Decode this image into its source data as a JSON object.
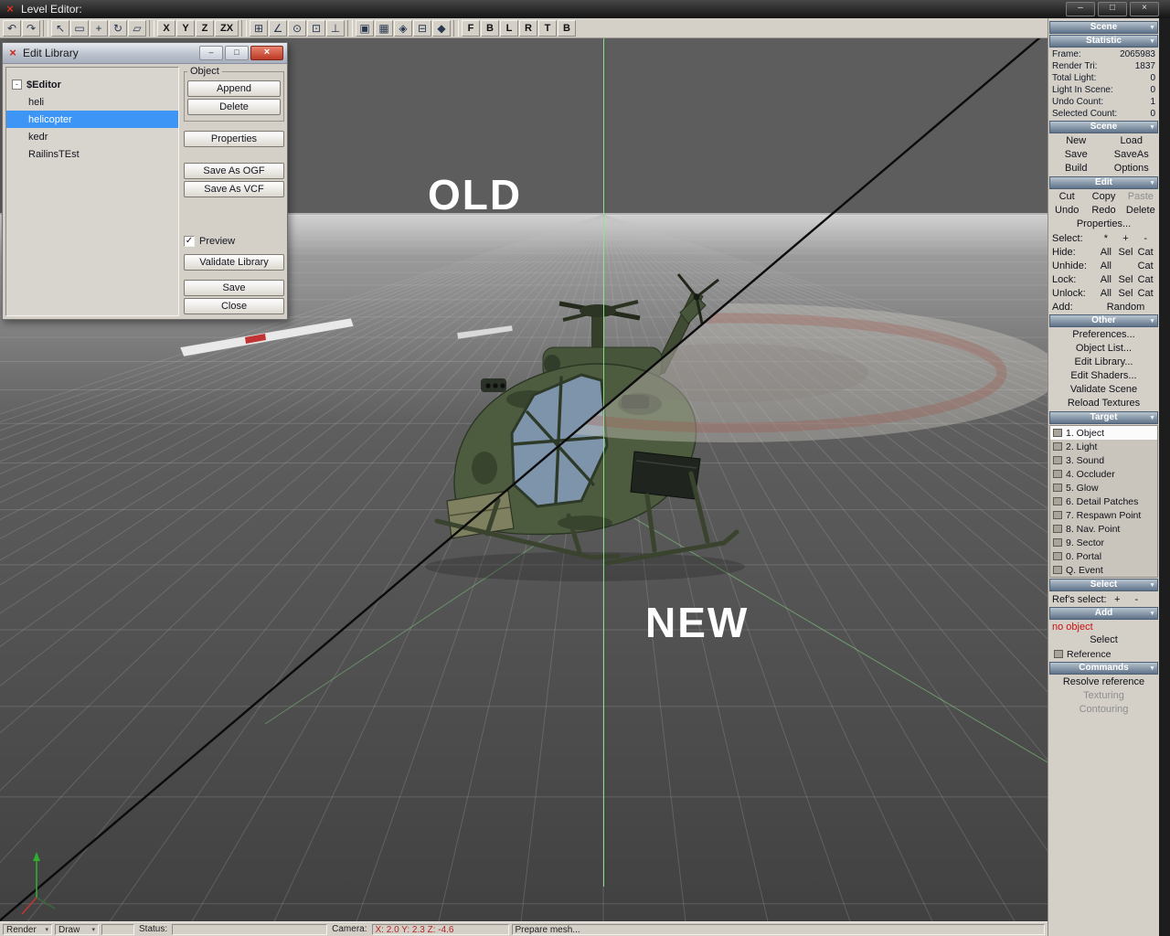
{
  "window": {
    "title": "Level Editor:"
  },
  "colors": {
    "selection_blue": "#3d95f5",
    "panel_header": "#65798d",
    "error_red": "#cc1010",
    "axis_green": "#8ce48c",
    "coords_red": "#b42222",
    "titlebar_dark": "#1c1c1c"
  },
  "toolbar": {
    "buttons": [
      {
        "name": "undo",
        "glyph": "↶"
      },
      {
        "name": "redo",
        "glyph": "↷"
      },
      {
        "sep": true
      },
      {
        "name": "select-tool",
        "glyph": "↖"
      },
      {
        "name": "select-rect-tool",
        "glyph": "▭"
      },
      {
        "name": "move-tool",
        "glyph": "+"
      },
      {
        "name": "rotate-tool",
        "glyph": "↻"
      },
      {
        "name": "scale-tool",
        "glyph": "▱"
      },
      {
        "sep": true
      },
      {
        "name": "axis-x",
        "glyph": "X",
        "letter": true
      },
      {
        "name": "axis-y",
        "glyph": "Y",
        "letter": true
      },
      {
        "name": "axis-z",
        "glyph": "Z",
        "letter": true
      },
      {
        "name": "axis-zx",
        "glyph": "ZX",
        "letter": true,
        "wide": true
      },
      {
        "sep": true
      },
      {
        "name": "grid-snap",
        "glyph": "⊞"
      },
      {
        "name": "angle-snap",
        "glyph": "∠"
      },
      {
        "name": "vertex-snap",
        "glyph": "⊙"
      },
      {
        "name": "face-snap",
        "glyph": "⊡"
      },
      {
        "name": "normal-align",
        "glyph": "⊥"
      },
      {
        "sep": true
      },
      {
        "name": "render-fill",
        "glyph": "▣"
      },
      {
        "name": "render-wire",
        "glyph": "▦"
      },
      {
        "name": "render-points",
        "glyph": "◈"
      },
      {
        "name": "show-grid",
        "glyph": "⊟"
      },
      {
        "name": "show-axis",
        "glyph": "◆"
      },
      {
        "sep": true
      },
      {
        "name": "view-front",
        "glyph": "F",
        "letter": true
      },
      {
        "name": "view-back",
        "glyph": "B",
        "letter": true
      },
      {
        "name": "view-left",
        "glyph": "L",
        "letter": true
      },
      {
        "name": "view-right",
        "glyph": "R",
        "letter": true
      },
      {
        "name": "view-top",
        "glyph": "T",
        "letter": true
      },
      {
        "name": "view-bottom",
        "glyph": "B",
        "letter": true
      }
    ]
  },
  "viewport": {
    "old_label": "OLD",
    "new_label": "NEW"
  },
  "panel": {
    "top_combo": "Scene",
    "statistic": {
      "header": "Statistic",
      "rows": [
        [
          "Frame:",
          "2065983"
        ],
        [
          "Render Tri:",
          "1837"
        ],
        [
          "Total Light:",
          "0"
        ],
        [
          "Light In Scene:",
          "0"
        ],
        [
          "Undo Count:",
          "1"
        ],
        [
          "Selected Count:",
          "0"
        ]
      ]
    },
    "scene": {
      "header": "Scene",
      "buttons": [
        "New",
        "Load",
        "Save",
        "SaveAs",
        "Build",
        "Options"
      ]
    },
    "edit": {
      "header": "Edit",
      "rows": [
        [
          {
            "label": "Cut"
          },
          {
            "label": "Copy"
          },
          {
            "label": "Paste",
            "disabled": true
          }
        ],
        [
          {
            "label": "Undo"
          },
          {
            "label": "Redo"
          },
          {
            "label": "Delete"
          }
        ],
        [
          {
            "label": "Properties..."
          }
        ]
      ],
      "select_rows": [
        {
          "label": "Select:",
          "options": [
            "*",
            "+",
            "-"
          ]
        },
        {
          "label": "Hide:",
          "options": [
            "All",
            "Sel",
            "Cat"
          ]
        },
        {
          "label": "Unhide:",
          "options": [
            "All",
            "",
            "Cat"
          ]
        },
        {
          "label": "Lock:",
          "options": [
            "All",
            "Sel",
            "Cat"
          ]
        },
        {
          "label": "Unlock:",
          "options": [
            "All",
            "Sel",
            "Cat"
          ]
        },
        {
          "label": "Add:",
          "options": [
            "",
            "Random",
            ""
          ]
        }
      ]
    },
    "other": {
      "header": "Other",
      "items": [
        "Preferences...",
        "Object List...",
        "Edit Library...",
        "Edit Shaders...",
        "Validate Scene",
        "Reload Textures"
      ]
    },
    "target": {
      "header": "Target",
      "items": [
        {
          "label": "1. Object",
          "selected": true
        },
        {
          "label": "2. Light"
        },
        {
          "label": "3. Sound"
        },
        {
          "label": "4. Occluder"
        },
        {
          "label": "5. Glow"
        },
        {
          "label": "6. Detail Patches"
        },
        {
          "label": "7. Respawn Point"
        },
        {
          "label": "8. Nav. Point"
        },
        {
          "label": "9. Sector"
        },
        {
          "label": "0. Portal"
        },
        {
          "label": "Q. Event"
        }
      ]
    },
    "select_section": {
      "header": "Select",
      "refs_label": "Ref's select:",
      "refs_options": [
        "+",
        "-"
      ]
    },
    "add_section": {
      "header": "Add",
      "no_object": "no object",
      "select_label": "Select",
      "reference_label": "Reference"
    },
    "commands": {
      "header": "Commands",
      "items": [
        {
          "label": "Resolve reference"
        },
        {
          "label": "Texturing",
          "disabled": true
        },
        {
          "label": "Contouring",
          "disabled": true
        }
      ]
    }
  },
  "dialog": {
    "title": "Edit Library",
    "tree": [
      {
        "label": "$Editor",
        "root": true
      },
      {
        "label": "heli",
        "child": true
      },
      {
        "label": "helicopter",
        "child": true,
        "selected": true
      },
      {
        "label": "kedr",
        "child": true
      },
      {
        "label": "RailinsTEst",
        "child": true
      }
    ],
    "group_label": "Object",
    "group_buttons": [
      "Append",
      "Delete"
    ],
    "mid_buttons": [
      "Properties"
    ],
    "save_buttons": [
      "Save As OGF",
      "Save As VCF"
    ],
    "preview_label": "Preview",
    "preview_checked": true,
    "bottom_buttons": [
      {
        "label": "Validate Library"
      },
      {
        "label": "Save",
        "gap": true
      },
      {
        "label": "Close"
      }
    ]
  },
  "statusbar": {
    "render": "Render",
    "draw": "Draw",
    "status_label": "Status:",
    "camera_label": "Camera:",
    "camera_coords": "X: 2.0 Y: 2.3 Z: -4.6",
    "message": "Prepare mesh..."
  }
}
